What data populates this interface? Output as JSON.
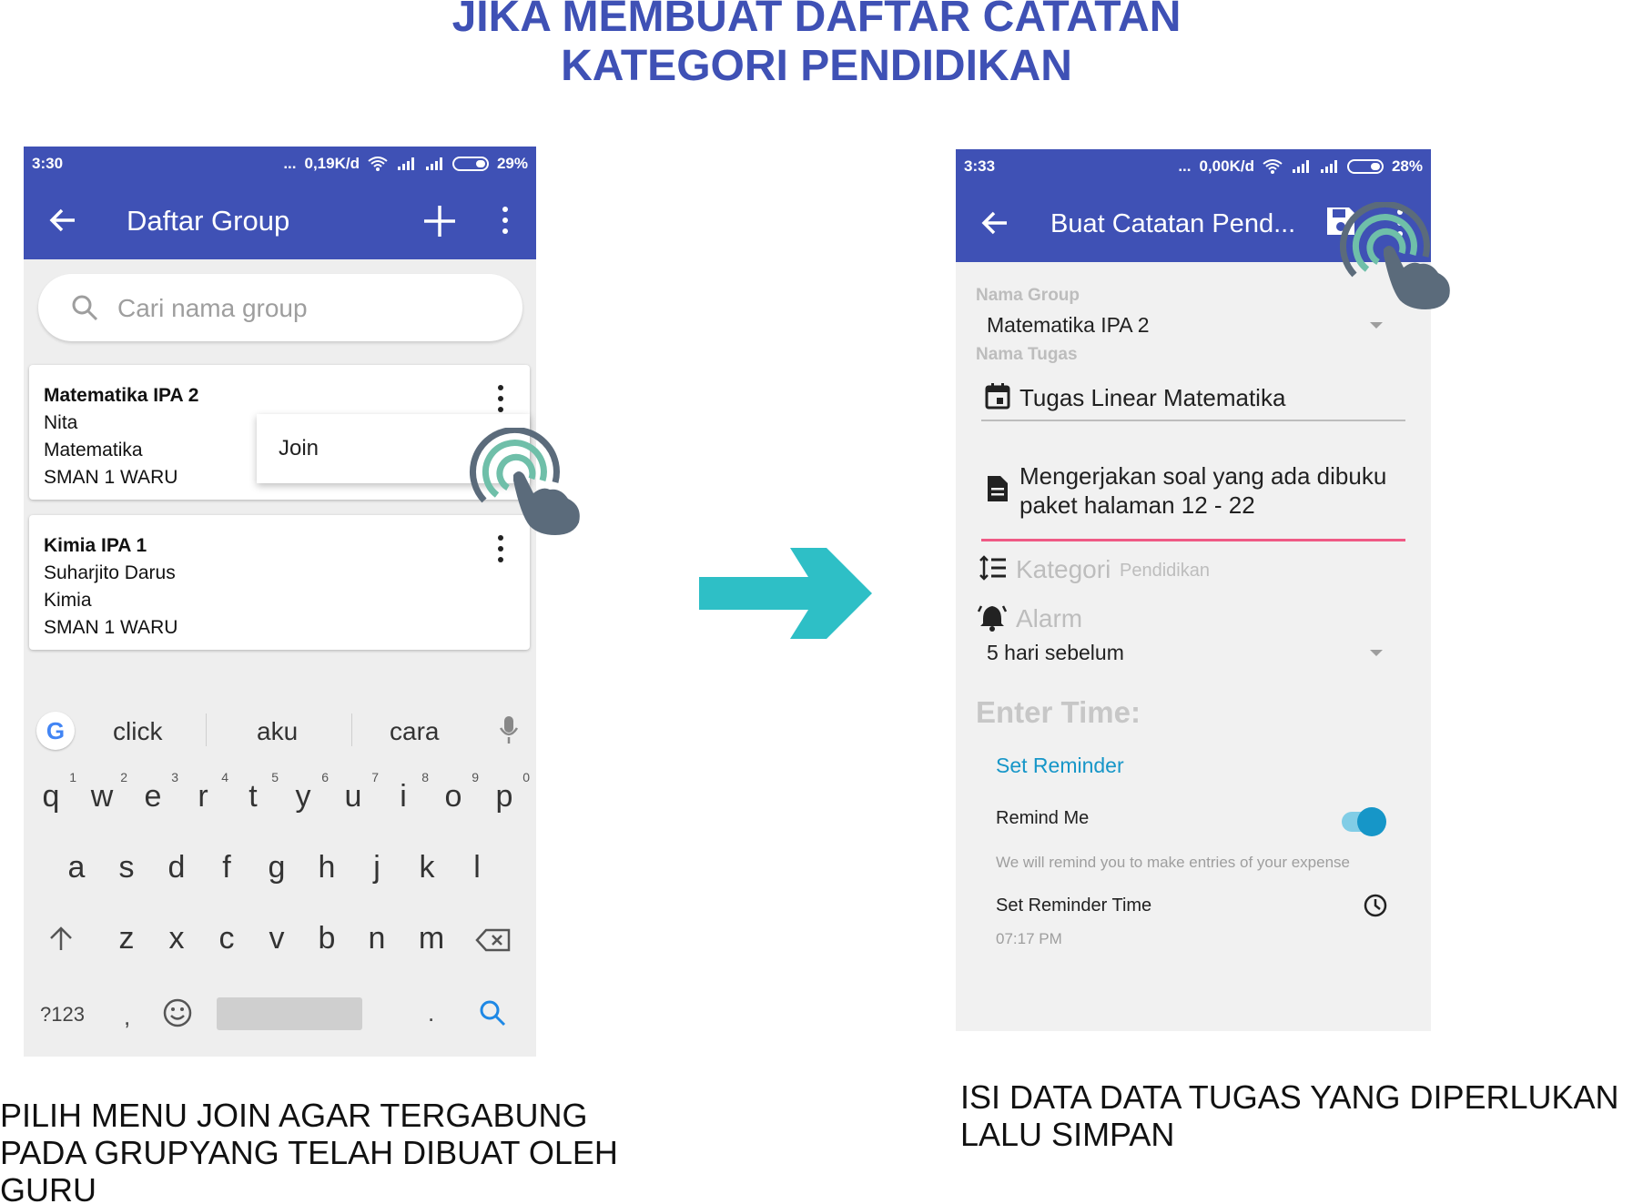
{
  "heading": {
    "line1": "JIKA MEMBUAT DAFTAR CATATAN",
    "line2": "KATEGORI PENDIDIKAN"
  },
  "left_phone": {
    "status": {
      "time": "3:30",
      "dots": "...",
      "speed": "0,19K/d",
      "battery": "29%"
    },
    "appbar": {
      "title": "Daftar Group",
      "back_icon": "arrow-left-icon",
      "add_icon": "plus-icon",
      "menu_icon": "more-vert-icon"
    },
    "search": {
      "placeholder": "Cari nama group",
      "icon": "search-icon"
    },
    "groups": [
      {
        "name": "Matematika IPA 2",
        "teacher": "Nita",
        "subject": "Matematika",
        "school": "SMAN 1 WARU"
      },
      {
        "name": "Kimia IPA 1",
        "teacher": "Suharjito Darus",
        "subject": "Kimia",
        "school": "SMAN 1 WARU"
      }
    ],
    "popup_menu": {
      "join": "Join"
    },
    "keyboard": {
      "suggestions": [
        "click",
        "aku",
        "cara"
      ],
      "row1": [
        "q",
        "w",
        "e",
        "r",
        "t",
        "y",
        "u",
        "i",
        "o",
        "p"
      ],
      "row1_digits": [
        "1",
        "2",
        "3",
        "4",
        "5",
        "6",
        "7",
        "8",
        "9",
        "0"
      ],
      "row2": [
        "a",
        "s",
        "d",
        "f",
        "g",
        "h",
        "j",
        "k",
        "l"
      ],
      "row3": [
        "z",
        "x",
        "c",
        "v",
        "b",
        "n",
        "m"
      ],
      "sym_key": "?123",
      "comma": ",",
      "period": ".",
      "google_logo": "G"
    }
  },
  "right_phone": {
    "status": {
      "time": "3:33",
      "dots": "...",
      "speed": "0,00K/d",
      "battery": "28%"
    },
    "appbar": {
      "title": "Buat Catatan Pend...",
      "back_icon": "arrow-left-icon",
      "save_icon": "save-icon",
      "menu_icon": "more-vert-icon"
    },
    "form": {
      "group_label": "Nama Group",
      "group_value": "Matematika IPA 2",
      "task_label": "Nama Tugas",
      "task_value": "Tugas Linear Matematika",
      "desc_line1": "Mengerjakan soal yang ada dibuku",
      "desc_line2": "paket halaman 12 - 22",
      "category_label": "Kategori",
      "category_value": "Pendidikan",
      "alarm_label": "Alarm",
      "alarm_value": "5 hari sebelum",
      "enter_time": "Enter Time:",
      "set_reminder": "Set Reminder",
      "remind_me": "Remind Me",
      "remind_me_on": true,
      "remind_sub": "We will remind you to make entries of your expense",
      "reminder_time_label": "Set Reminder Time",
      "reminder_time_value": "07:17 PM"
    }
  },
  "captions": {
    "left": "PILIH MENU JOIN AGAR TERGABUNG PADA GRUPYANG TELAH DIBUAT OLEH GURU",
    "right": "ISI DATA DATA TUGAS YANG DIPERLUKAN LALU SIMPAN"
  },
  "colors": {
    "primary": "#3f51b5",
    "arrow": "#2ebfc6",
    "accent_pink": "#ef5a85",
    "accent_blue": "#1696c8",
    "touch_ring": "#6fbfa9",
    "hand": "#5b6b7b"
  }
}
